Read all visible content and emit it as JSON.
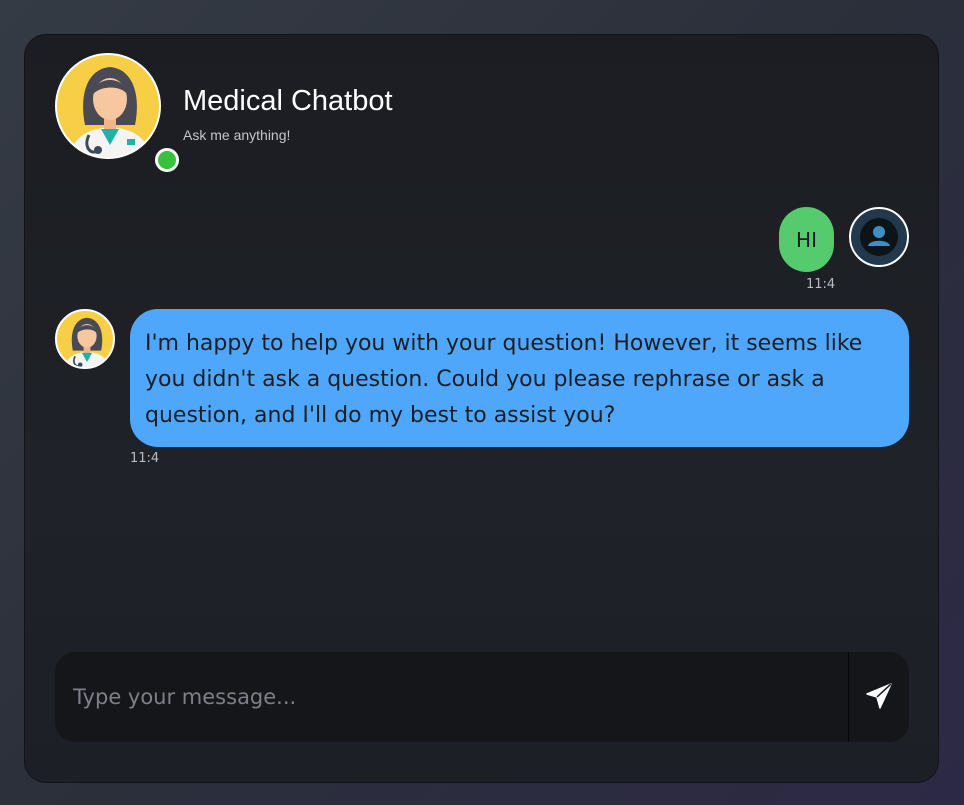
{
  "header": {
    "title": "Medical Chatbot",
    "subtitle": "Ask me anything!",
    "bot_avatar_icon": "doctor-avatar-icon",
    "status_color": "#36c23b"
  },
  "messages": [
    {
      "sender": "user",
      "text": "HI",
      "time": "11:4",
      "bubble_color": "#55cb6d",
      "avatar_icon": "user-icon"
    },
    {
      "sender": "bot",
      "text": "I'm happy to help you with your question! However, it seems like you didn't ask a question. Could you please rephrase or ask a question, and I'll do my best to assist you?",
      "time": "11:4",
      "bubble_color": "#4fa7fc",
      "avatar_icon": "doctor-avatar-icon"
    }
  ],
  "composer": {
    "placeholder": "Type your message...",
    "value": "",
    "send_icon": "send-icon"
  }
}
